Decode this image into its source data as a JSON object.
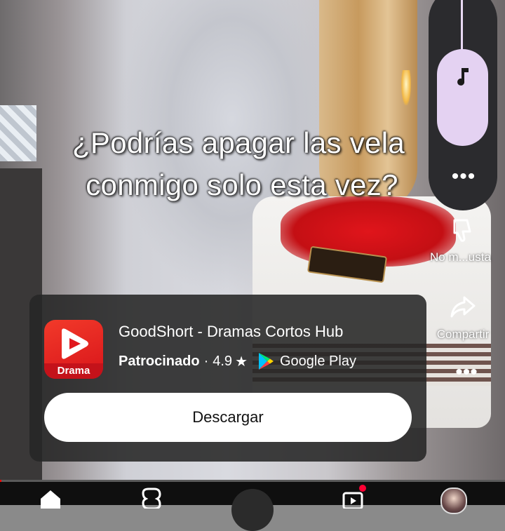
{
  "video": {
    "subtitle_line1": "¿Podrías apagar las vela",
    "subtitle_line2": "conmigo solo esta vez?"
  },
  "rail": {
    "sound_icon": "music-note-icon",
    "more_icon": "more-horizontal-icon",
    "dislike_label": "No m...usta",
    "share_label": "Compartir"
  },
  "ad": {
    "app_icon_label": "Drama",
    "app_name": "GoodShort - Dramas Cortos Hub",
    "sponsored": "Patrocinado",
    "separator": "·",
    "rating": "4.9",
    "rating_star": "★",
    "store_name": "Google Play",
    "download_label": "Descargar"
  },
  "progress": {
    "value_percent": 0.3
  },
  "colors": {
    "accent_red": "#ff0000",
    "sound_button": "#e4d2f2",
    "card_bg": "#262626"
  }
}
